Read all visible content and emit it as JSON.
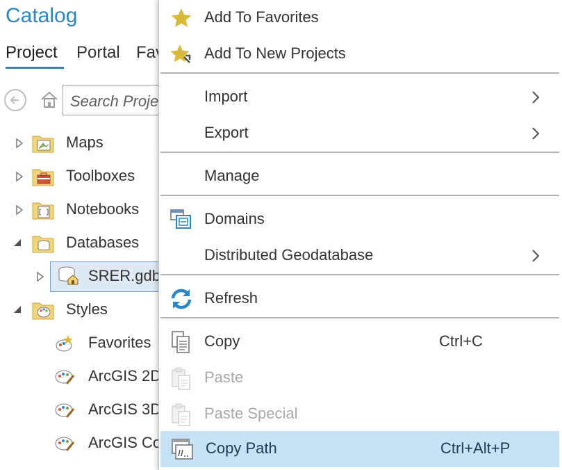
{
  "catalog": {
    "title": "Catalog",
    "tabs": [
      "Project",
      "Portal",
      "Fav"
    ],
    "search_placeholder": "Search Proje",
    "tree": [
      {
        "label": "Maps"
      },
      {
        "label": "Toolboxes"
      },
      {
        "label": "Notebooks"
      },
      {
        "label": "Databases"
      },
      {
        "label": "SRER.gdb"
      },
      {
        "label": "Styles"
      },
      {
        "label": "Favorites"
      },
      {
        "label": "ArcGIS 2D"
      },
      {
        "label": "ArcGIS 3D"
      },
      {
        "label": "ArcGIS Co"
      }
    ]
  },
  "menu": {
    "items": [
      {
        "label": "Add To Favorites",
        "icon": "star-icon"
      },
      {
        "label": "Add To New Projects",
        "icon": "star-pin-icon"
      },
      {
        "label": "Import",
        "has_submenu": true
      },
      {
        "label": "Export",
        "has_submenu": true
      },
      {
        "label": "Manage"
      },
      {
        "label": "Domains",
        "icon": "domains-icon"
      },
      {
        "label": "Distributed Geodatabase",
        "has_submenu": true
      },
      {
        "label": "Refresh",
        "icon": "refresh-icon"
      },
      {
        "label": "Copy",
        "shortcut": "Ctrl+C",
        "icon": "copy-icon"
      },
      {
        "label": "Paste",
        "disabled": true,
        "icon": "paste-icon"
      },
      {
        "label": "Paste Special",
        "disabled": true,
        "icon": "paste-special-icon"
      },
      {
        "label": "Copy Path",
        "shortcut": "Ctrl+Alt+P",
        "icon": "copy-path-icon",
        "highlighted": true
      }
    ]
  },
  "colors": {
    "accent": "#2a86c8",
    "highlight": "#c6e2f5",
    "selection": "#dfe9f4",
    "star": "#d8b93a",
    "refresh": "#2a86c8"
  }
}
